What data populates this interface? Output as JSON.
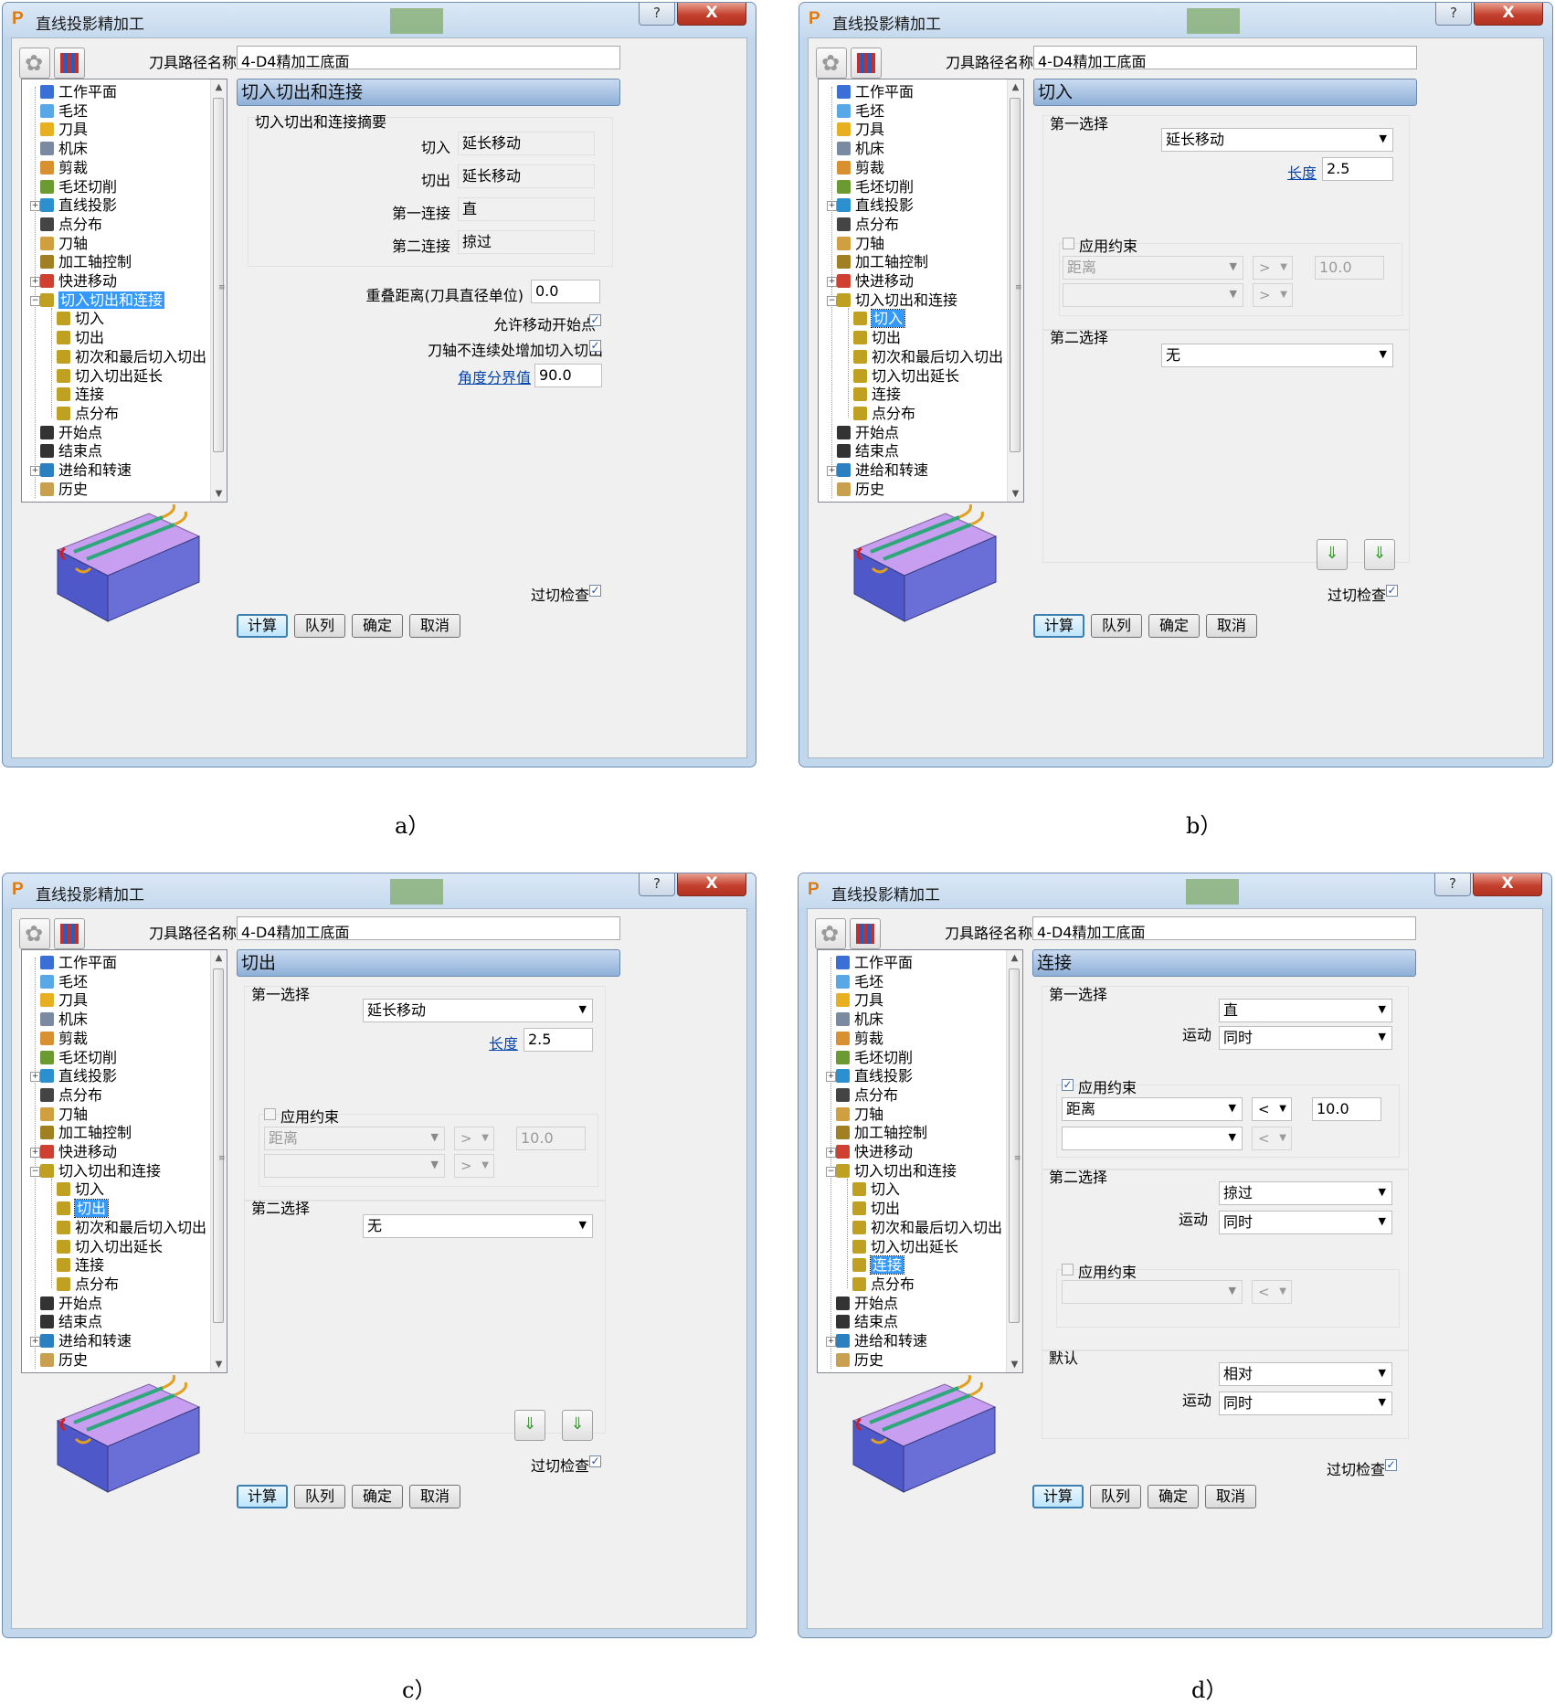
{
  "common": {
    "window_title": "直线投影精加工",
    "help_glyph": "?",
    "close_glyph": "X",
    "app_icon_glyph": "P",
    "toolpath_name_label": "刀具路径名称",
    "toolpath_name_value": "4-D4精加工底面",
    "tree": [
      "工作平面",
      "毛坯",
      "刀具",
      "机床",
      "剪裁",
      "毛坯切削",
      "直线投影",
      "点分布",
      "刀轴",
      "加工轴控制",
      "快进移动",
      "切入切出和连接",
      "切入",
      "切出",
      "初次和最后切入切出",
      "切入切出延长",
      "连接",
      "点分布",
      "开始点",
      "结束点",
      "进给和转速",
      "历史"
    ],
    "gouge_check_label": "过切检查",
    "buttons": {
      "calculate": "计算",
      "queue": "队列",
      "ok": "确定",
      "cancel": "取消"
    },
    "colors": {
      "accent_header": "#8fb0d8",
      "selection": "#3399ff",
      "link": "#0645ad"
    }
  },
  "panel_a": {
    "caption": "a）",
    "header": "切入切出和连接",
    "summary_title": "切入切出和连接摘要",
    "rows": [
      {
        "label": "切入",
        "value": "延长移动"
      },
      {
        "label": "切出",
        "value": "延长移动"
      },
      {
        "label": "第一连接",
        "value": "直"
      },
      {
        "label": "第二连接",
        "value": "掠过"
      }
    ],
    "overlap_label": "重叠距离(刀具直径单位)",
    "overlap_value": "0.0",
    "allow_start_label": "允许移动开始点",
    "add_on_discontinuity_label": "刀轴不连续处增加切入切出",
    "angle_link": "角度分界值",
    "angle_value": "90.0"
  },
  "panel_b": {
    "caption": "b）",
    "header": "切入",
    "first_choice_label": "第一选择",
    "first_choice_value": "延长移动",
    "length_link": "长度",
    "length_value": "2.5",
    "apply_constraint_label": "应用约束",
    "constraint_type": "距离",
    "op1": ">",
    "op2": ">",
    "constraint_value": "10.0",
    "second_choice_label": "第二选择",
    "second_choice_value": "无"
  },
  "panel_c": {
    "caption": "c）",
    "header": "切出",
    "first_choice_label": "第一选择",
    "first_choice_value": "延长移动",
    "length_link": "长度",
    "length_value": "2.5",
    "apply_constraint_label": "应用约束",
    "constraint_type": "距离",
    "op1": ">",
    "op2": ">",
    "constraint_value": "10.0",
    "second_choice_label": "第二选择",
    "second_choice_value": "无"
  },
  "panel_d": {
    "caption": "d）",
    "header": "连接",
    "first_choice_label": "第一选择",
    "first_choice_value": "直",
    "motion_label": "运动",
    "first_motion": "同时",
    "apply_constraint_label": "应用约束",
    "constraint_type": "距离",
    "op1": "<",
    "constraint_value": "10.0",
    "op2": "<",
    "second_choice_label": "第二选择",
    "second_choice_value": "掠过",
    "second_motion": "同时",
    "op3": "<",
    "default_label": "默认",
    "default_value": "相对",
    "default_motion": "同时"
  }
}
